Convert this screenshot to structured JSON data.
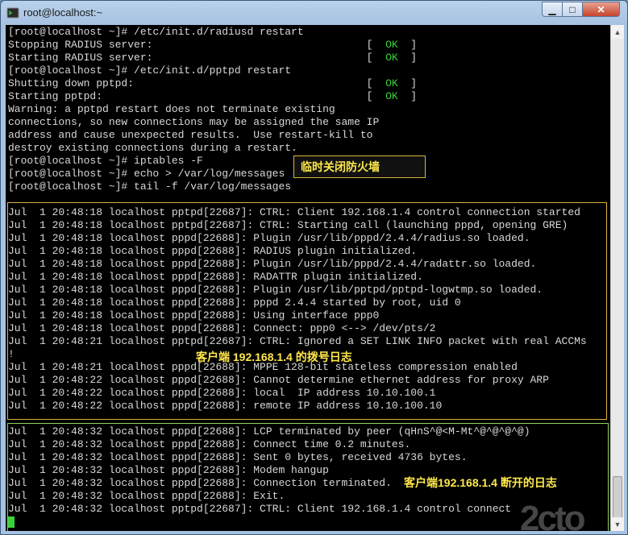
{
  "window": {
    "title": "root@localhost:~"
  },
  "controls": {
    "minimize": "▁",
    "maximize": "□",
    "close": "✕"
  },
  "terminal": {
    "lines": [
      {
        "text": "[root@localhost ~]# /etc/init.d/radiusd restart"
      },
      {
        "text": "Stopping RADIUS server:                                  [  ",
        "ok": "OK",
        "tail": "  ]"
      },
      {
        "text": "Starting RADIUS server:                                  [  ",
        "ok": "OK",
        "tail": "  ]"
      },
      {
        "text": "[root@localhost ~]# /etc/init.d/pptpd restart"
      },
      {
        "text": "Shutting down pptpd:                                     [  ",
        "ok": "OK",
        "tail": "  ]"
      },
      {
        "text": "Starting pptpd:                                          [  ",
        "ok": "OK",
        "tail": "  ]"
      },
      {
        "text": "Warning: a pptpd restart does not terminate existing"
      },
      {
        "text": "connections, so new connections may be assigned the same IP"
      },
      {
        "text": "address and cause unexpected results.  Use restart-kill to"
      },
      {
        "text": "destroy existing connections during a restart."
      },
      {
        "text": "[root@localhost ~]# iptables -F"
      },
      {
        "text": "[root@localhost ~]# echo > /var/log/messages"
      },
      {
        "text": "[root@localhost ~]# tail -f /var/log/messages"
      },
      {
        "text": ""
      },
      {
        "text": "Jul  1 20:48:18 localhost pptpd[22687]: CTRL: Client 192.168.1.4 control connection started"
      },
      {
        "text": "Jul  1 20:48:18 localhost pptpd[22687]: CTRL: Starting call (launching pppd, opening GRE)"
      },
      {
        "text": "Jul  1 20:48:18 localhost pppd[22688]: Plugin /usr/lib/pppd/2.4.4/radius.so loaded."
      },
      {
        "text": "Jul  1 20:48:18 localhost pppd[22688]: RADIUS plugin initialized."
      },
      {
        "text": "Jul  1 20:48:18 localhost pppd[22688]: Plugin /usr/lib/pppd/2.4.4/radattr.so loaded."
      },
      {
        "text": "Jul  1 20:48:18 localhost pppd[22688]: RADATTR plugin initialized."
      },
      {
        "text": "Jul  1 20:48:18 localhost pppd[22688]: Plugin /usr/lib/pptpd/pptpd-logwtmp.so loaded."
      },
      {
        "text": "Jul  1 20:48:18 localhost pppd[22688]: pppd 2.4.4 started by root, uid 0"
      },
      {
        "text": "Jul  1 20:48:18 localhost pppd[22688]: Using interface ppp0"
      },
      {
        "text": "Jul  1 20:48:18 localhost pppd[22688]: Connect: ppp0 <--> /dev/pts/2"
      },
      {
        "text": "Jul  1 20:48:21 localhost pptpd[22687]: CTRL: Ignored a SET LINK INFO packet with real ACCMs"
      },
      {
        "text": "!"
      },
      {
        "text": "Jul  1 20:48:21 localhost pppd[22688]: MPPE 128-bit stateless compression enabled"
      },
      {
        "text": "Jul  1 20:48:22 localhost pppd[22688]: Cannot determine ethernet address for proxy ARP"
      },
      {
        "text": "Jul  1 20:48:22 localhost pppd[22688]: local  IP address 10.10.100.1"
      },
      {
        "text": "Jul  1 20:48:22 localhost pppd[22688]: remote IP address 10.10.100.10"
      },
      {
        "text": ""
      },
      {
        "text": "Jul  1 20:48:32 localhost pppd[22688]: LCP terminated by peer (qHnS^@<M-Mt^@^@^@^@)"
      },
      {
        "text": "Jul  1 20:48:32 localhost pppd[22688]: Connect time 0.2 minutes."
      },
      {
        "text": "Jul  1 20:48:32 localhost pppd[22688]: Sent 0 bytes, received 4736 bytes."
      },
      {
        "text": "Jul  1 20:48:32 localhost pppd[22688]: Modem hangup"
      },
      {
        "text": "Jul  1 20:48:32 localhost pppd[22688]: Connection terminated."
      },
      {
        "text": "Jul  1 20:48:32 localhost pppd[22688]: Exit."
      },
      {
        "text": "Jul  1 20:48:32 localhost pptpd[22687]: CTRL: Client 192.168.1.4 control connect"
      }
    ]
  },
  "annotations": {
    "firewall": "临时关闭防火墙",
    "dialup": "客户端 192.168.1.4 的拨号日志",
    "disconnect": "客户端192.168.1.4 断开的日志"
  },
  "watermark": "2cto",
  "colors": {
    "terminal_bg": "#000000",
    "text": "#d8d8d8",
    "ok": "#3ad23a",
    "annotation": "#ffe84a"
  }
}
